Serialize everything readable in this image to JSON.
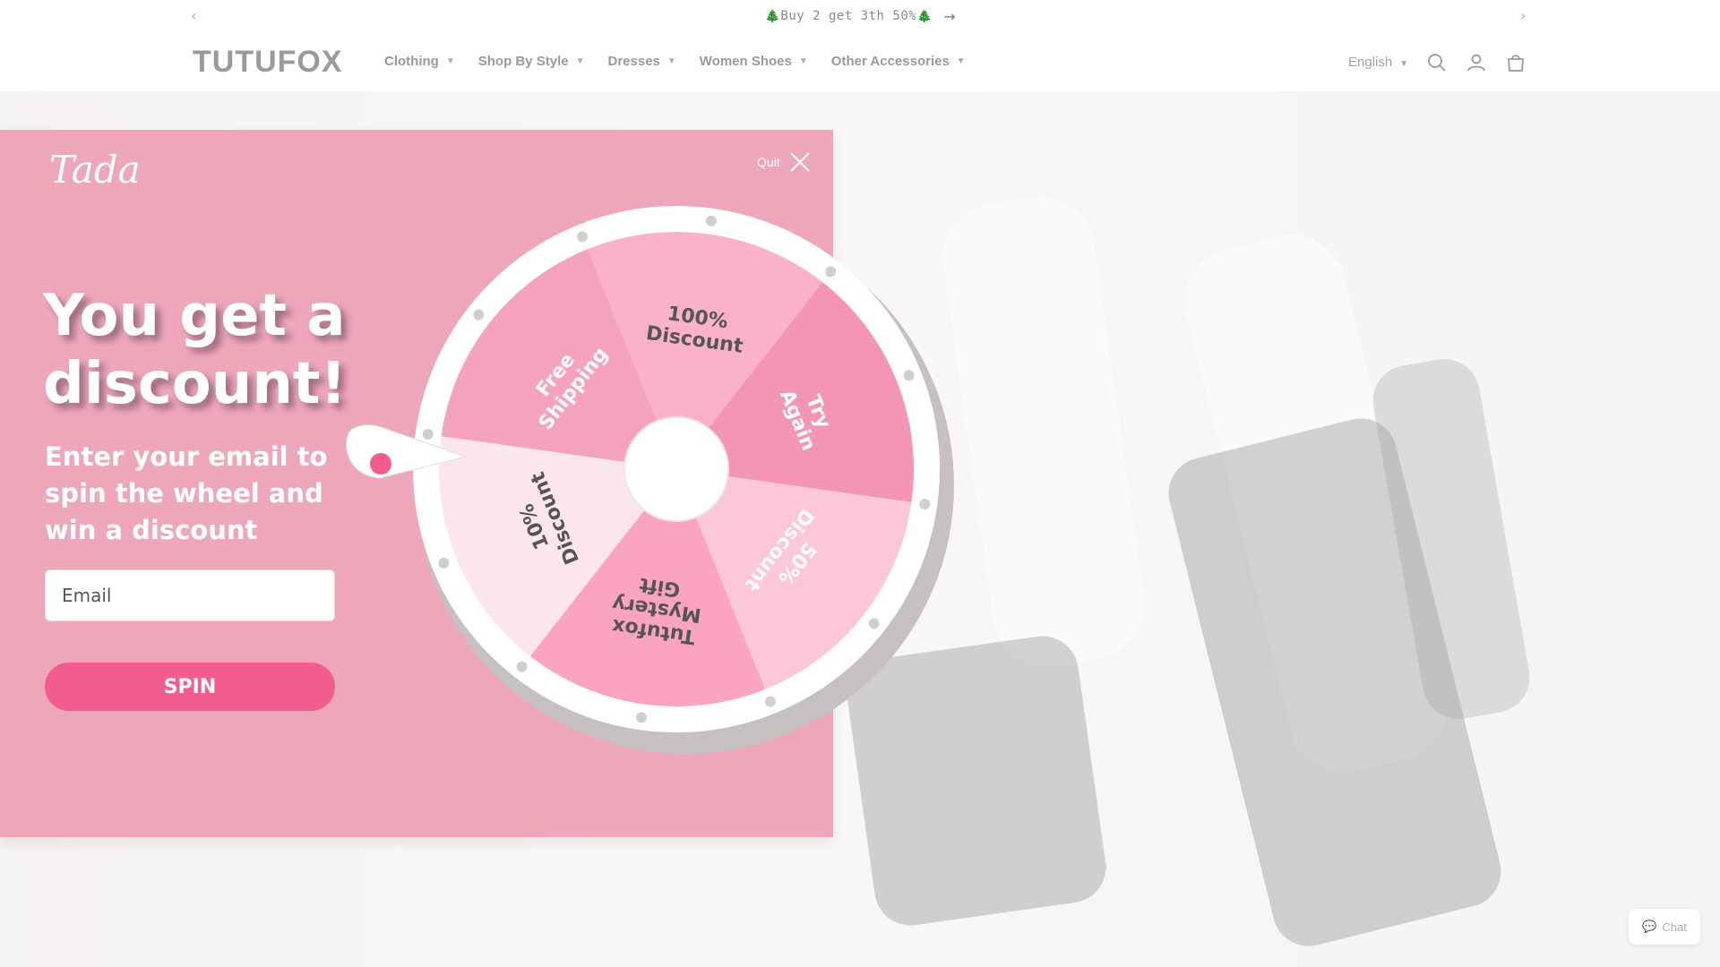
{
  "announcement": {
    "text": "🎄Buy 2 get 3th 50%🎄",
    "arrow": "→",
    "prev": "‹",
    "next": "›"
  },
  "header": {
    "logo": "TUTUFOX",
    "nav": [
      {
        "label": "Clothing"
      },
      {
        "label": "Shop By Style"
      },
      {
        "label": "Dresses"
      },
      {
        "label": "Women Shoes"
      },
      {
        "label": "Other Accessories"
      }
    ],
    "language": "English",
    "icons": [
      "search-icon",
      "account-icon",
      "cart-icon"
    ]
  },
  "popup": {
    "brand": "Tada",
    "quit_label": "Quit",
    "headline": "You get a discount!",
    "subtext": "Enter your email to spin the wheel and win a discount",
    "email_placeholder": "Email",
    "spin_label": "SPIN",
    "wheel": {
      "segments": [
        {
          "label": "100% Discount",
          "color": "#fbb0cc"
        },
        {
          "label": "Try Again",
          "color": "#f595b5"
        },
        {
          "label": "50% Discount",
          "color": "#fcc7d7"
        },
        {
          "label": "Tutufox Mystery Gift",
          "color": "#fba4c2"
        },
        {
          "label": "10% Discount",
          "color": "#fde5ec"
        },
        {
          "label": "Free Shipping",
          "color": "#f5a2be"
        }
      ],
      "pointer_color": "#f35c8f"
    }
  },
  "chat_label": "Chat",
  "colors": {
    "popup_bg": "#eea6bb",
    "accent": "#f35c8f"
  }
}
